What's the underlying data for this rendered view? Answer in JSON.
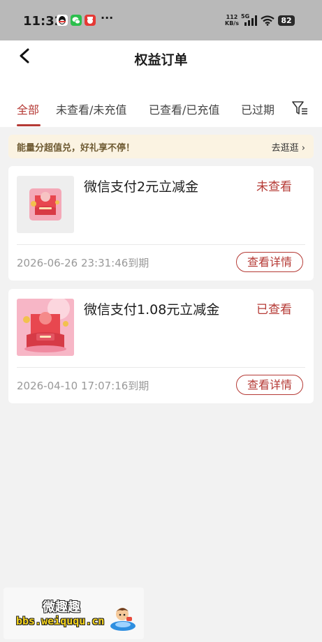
{
  "status_bar": {
    "time": "11:32",
    "more": "···",
    "speed_value": "112",
    "speed_unit": "KB/s",
    "network": "5G",
    "battery": "82"
  },
  "header": {
    "title": "权益订单"
  },
  "tabs": [
    {
      "label": "全部",
      "active": true
    },
    {
      "label": "未查看/未充值",
      "active": false
    },
    {
      "label": "已查看/已充值",
      "active": false
    },
    {
      "label": "已过期",
      "active": false
    }
  ],
  "banner": {
    "text": "能量分超值兑，好礼享不停！",
    "link": "去逛逛 ›"
  },
  "orders": [
    {
      "title": "微信支付2元立减金",
      "status": "未查看",
      "expiry": "2026-06-26 23:31:46到期",
      "button": "查看详情"
    },
    {
      "title": "微信支付1.08元立减金",
      "status": "已查看",
      "expiry": "2026-04-10 17:07:16到期",
      "button": "查看详情"
    }
  ],
  "watermark": {
    "name": "微趣趣",
    "url": "bbs.weiququ.cn"
  },
  "colors": {
    "accent": "#b53a35",
    "banner_bg": "#fbf3e2",
    "page_bg": "#f2f2f2"
  },
  "icons": [
    "back-arrow-icon",
    "filter-icon",
    "qq-icon",
    "wechat-icon",
    "app-icon",
    "signal-icon",
    "wifi-icon",
    "battery-icon"
  ]
}
